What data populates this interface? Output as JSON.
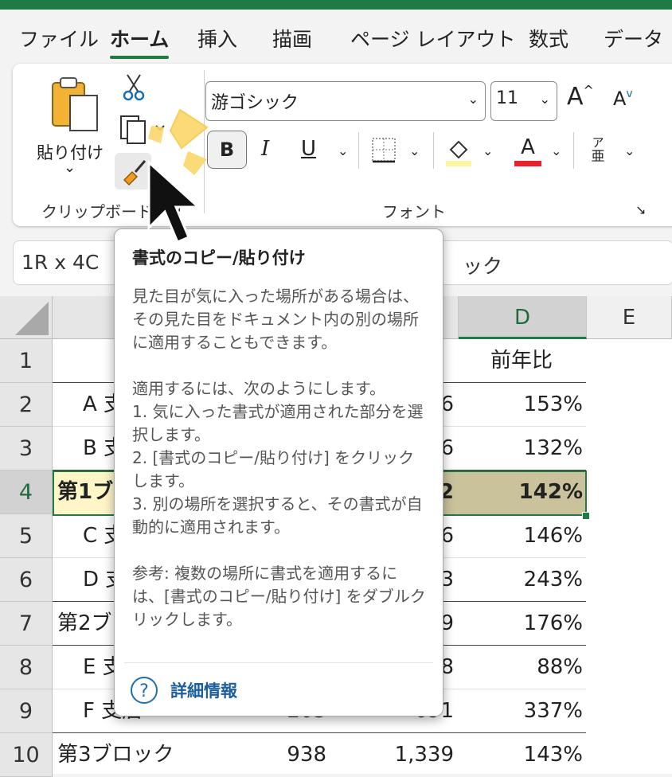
{
  "tabs": [
    "ファイル",
    "ホーム",
    "挿入",
    "描画",
    "ページ レイアウト",
    "数式",
    "データ"
  ],
  "active_tab": "ホーム",
  "ribbon": {
    "clipboard": {
      "paste_label": "貼り付け",
      "paste_chevron": "⌄",
      "group_label": "クリップボード"
    },
    "font": {
      "font_name": "游ゴシック",
      "font_size": "11",
      "grow_font": "A",
      "shrink_font": "A",
      "bold": "B",
      "italic": "I",
      "underline": "U",
      "font_color_letter": "A",
      "phonetic_top": "ア",
      "phonetic_bottom": "亜",
      "group_label": "フォント"
    },
    "colors": {
      "accent": "#1f7a43",
      "font_color_bar": "#e8202a",
      "fill_color_bar": "#fff59d"
    }
  },
  "name_box": "1R x 4C",
  "formula_fragment": "ック",
  "sheet": {
    "columns": [
      "D",
      "E"
    ],
    "rows": [
      {
        "num": "1",
        "a": "（",
        "b": "",
        "c": "",
        "d": "前年比"
      },
      {
        "num": "2",
        "a": "A 支",
        "b": "",
        "c": "6",
        "d": "153%"
      },
      {
        "num": "3",
        "a": "B 支",
        "b": "",
        "c": "6",
        "d": "132%"
      },
      {
        "num": "4",
        "a": "第1ブ",
        "b": "",
        "c": "2",
        "d": "142%"
      },
      {
        "num": "5",
        "a": "C 支",
        "b": "",
        "c": "6",
        "d": "146%"
      },
      {
        "num": "6",
        "a": "D 支",
        "b": "",
        "c": "3",
        "d": "243%"
      },
      {
        "num": "7",
        "a": "第2ブ",
        "b": "",
        "c": "9",
        "d": "176%"
      },
      {
        "num": "8",
        "a": "E 支",
        "b": "",
        "c": "8",
        "d": "88%"
      },
      {
        "num": "9",
        "a": "F 支店",
        "b": "203",
        "c": "691",
        "d": "337%"
      },
      {
        "num": "10",
        "a": "第3ブロック",
        "b": "938",
        "c": "1,339",
        "d": "143%"
      }
    ]
  },
  "tooltip": {
    "title": "書式のコピー/貼り付け",
    "para1": "見た目が気に入った場所がある場合は、その見た目をドキュメント内の別の場所に適用することもできます。",
    "para2_intro": "適用するには、次のようにします。",
    "step1": "1. 気に入った書式が適用された部分を選択します。",
    "step2": "2. [書式のコピー/貼り付け] をクリックします。",
    "step3": "3. 別の場所を選択すると、その書式が自動的に適用されます。",
    "note": "参考: 複数の場所に書式を適用するには、[書式のコピー/貼り付け] をダブルクリックします。",
    "help_icon": "?",
    "more_info": "詳細情報"
  }
}
